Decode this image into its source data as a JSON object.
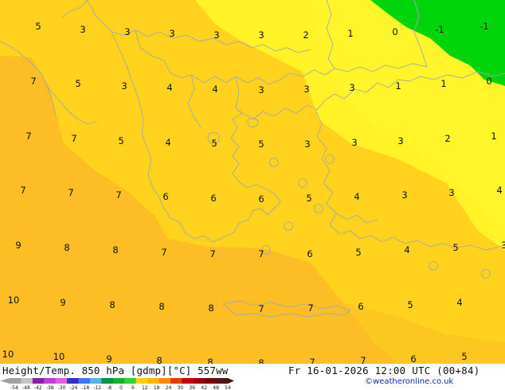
{
  "footer": {
    "title": "Height/Temp. 850 hPa [gdmp][°C] 557ww",
    "date": "Fr 16-01-2026 12:00 UTC (00+84)",
    "copyright": "©weatheronline.co.uk"
  },
  "legend": {
    "ticks": [
      "-54",
      "-48",
      "-42",
      "-38",
      "-30",
      "-24",
      "-18",
      "-12",
      "-8",
      "0",
      "6",
      "12",
      "18",
      "24",
      "30",
      "36",
      "42",
      "48",
      "54"
    ],
    "colors": [
      "#a0a0a0",
      "#c4c4c4",
      "#8c1fa8",
      "#c63cd8",
      "#e05ee8",
      "#3232c8",
      "#3c78f0",
      "#50b4f0",
      "#00963c",
      "#14b428",
      "#32d23c",
      "#ffd200",
      "#ffb400",
      "#ff8c00",
      "#e63c00",
      "#c80000",
      "#a00000",
      "#780000",
      "#501414"
    ]
  },
  "colors": {
    "field_yellow": "#ffd21e",
    "field_bright_yellow": "#fff226",
    "field_orange": "#fcbe24",
    "field_green": "#00d40a",
    "coastline": "#a8a8a8"
  },
  "labels": [
    {
      "t": "5"
    },
    {
      "t": "3"
    },
    {
      "t": "3"
    },
    {
      "t": "3"
    },
    {
      "t": "3"
    },
    {
      "t": "3"
    },
    {
      "t": "2"
    },
    {
      "t": "1"
    },
    {
      "t": "0"
    },
    {
      "t": "-1"
    },
    {
      "t": "-1"
    },
    {
      "t": "7"
    },
    {
      "t": "5"
    },
    {
      "t": "3"
    },
    {
      "t": "4"
    },
    {
      "t": "4"
    },
    {
      "t": "3"
    },
    {
      "t": "3"
    },
    {
      "t": "3"
    },
    {
      "t": "1"
    },
    {
      "t": "1"
    },
    {
      "t": "0"
    },
    {
      "t": "7"
    },
    {
      "t": "7"
    },
    {
      "t": "5"
    },
    {
      "t": "4"
    },
    {
      "t": "5"
    },
    {
      "t": "5"
    },
    {
      "t": "3"
    },
    {
      "t": "3"
    },
    {
      "t": "3"
    },
    {
      "t": "2"
    },
    {
      "t": "1"
    },
    {
      "t": "7"
    },
    {
      "t": "7"
    },
    {
      "t": "7"
    },
    {
      "t": "6"
    },
    {
      "t": "6"
    },
    {
      "t": "6"
    },
    {
      "t": "5"
    },
    {
      "t": "4"
    },
    {
      "t": "3"
    },
    {
      "t": "3"
    },
    {
      "t": "4"
    },
    {
      "t": "9"
    },
    {
      "t": "8"
    },
    {
      "t": "8"
    },
    {
      "t": "7"
    },
    {
      "t": "7"
    },
    {
      "t": "7"
    },
    {
      "t": "6"
    },
    {
      "t": "5"
    },
    {
      "t": "4"
    },
    {
      "t": "5"
    },
    {
      "t": "3"
    },
    {
      "t": "10"
    },
    {
      "t": "9"
    },
    {
      "t": "8"
    },
    {
      "t": "8"
    },
    {
      "t": "8"
    },
    {
      "t": "7"
    },
    {
      "t": "7"
    },
    {
      "t": "6"
    },
    {
      "t": "5"
    },
    {
      "t": "4"
    },
    {
      "t": "10"
    },
    {
      "t": "10"
    },
    {
      "t": "9"
    },
    {
      "t": "8"
    },
    {
      "t": "8"
    },
    {
      "t": "8"
    },
    {
      "t": "7"
    },
    {
      "t": "7"
    },
    {
      "t": "6"
    },
    {
      "t": "5"
    }
  ]
}
